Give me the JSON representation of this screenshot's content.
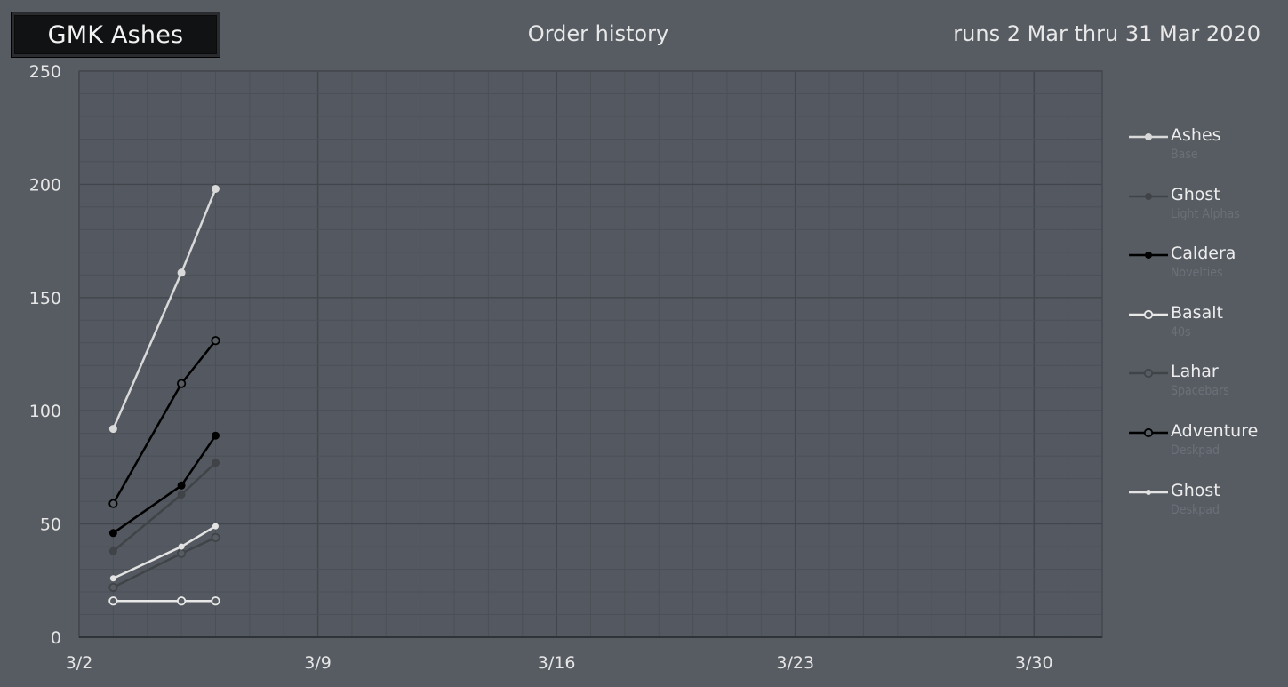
{
  "header": {
    "badge_text": "GMK Ashes",
    "title": "Order history",
    "date_range": "runs 2 Mar thru 31 Mar 2020"
  },
  "chart_data": {
    "type": "line",
    "title": "Order history",
    "xlabel": "",
    "ylabel": "",
    "xlim": [
      "2020-03-02",
      "2020-04-01"
    ],
    "ylim": [
      0,
      250
    ],
    "x_ticks": [
      "3/2",
      "3/9",
      "3/16",
      "3/23",
      "3/30"
    ],
    "y_ticks": [
      0,
      50,
      100,
      150,
      200,
      250
    ],
    "grid": true,
    "legend_placement": "right",
    "x": [
      "2020-03-03",
      "2020-03-05",
      "2020-03-06"
    ],
    "series": [
      {
        "name": "Ashes",
        "subtitle": "Base",
        "color": "#d9d9d9",
        "marker": "filled",
        "values": [
          92,
          161,
          198
        ]
      },
      {
        "name": "Ghost",
        "subtitle": "Light Alphas",
        "color": "#404347",
        "marker": "filled",
        "values": [
          38,
          63,
          77
        ]
      },
      {
        "name": "Caldera",
        "subtitle": "Novelties",
        "color": "#000000",
        "marker": "filled",
        "values": [
          46,
          67,
          89
        ]
      },
      {
        "name": "Basalt",
        "subtitle": "40s",
        "color": "#e8e8e8",
        "marker": "hollow",
        "values": [
          16,
          16,
          16
        ]
      },
      {
        "name": "Lahar",
        "subtitle": "Spacebars",
        "color": "#404347",
        "marker": "hollow",
        "values": [
          22,
          37,
          44
        ]
      },
      {
        "name": "Adventure",
        "subtitle": "Deskpad",
        "color": "#000000",
        "marker": "hollow",
        "values": [
          59,
          112,
          131
        ]
      },
      {
        "name": "Ghost",
        "subtitle": "Deskpad",
        "color": "#e3e3e3",
        "marker": "small",
        "values": [
          26,
          40,
          49
        ]
      }
    ]
  }
}
